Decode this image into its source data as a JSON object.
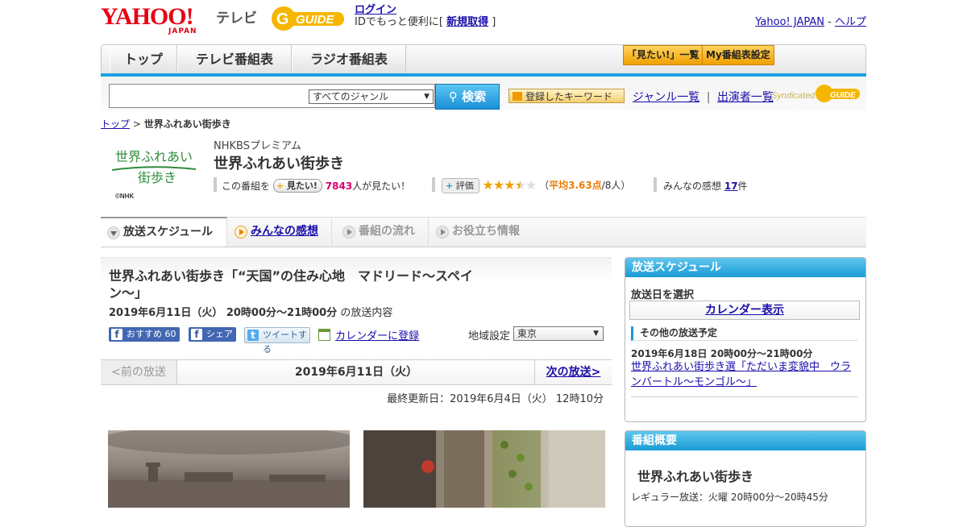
{
  "header": {
    "logo_text": "YAHOO!",
    "logo_sub": "JAPAN",
    "section": "テレビ",
    "gguide_text": "GUIDE",
    "login_link": "ログイン",
    "login_desc_pre": "IDでもっと便利に[",
    "register_link": "新規取得",
    "login_desc_post": "]",
    "yahoo_japan_link": "Yahoo! JAPAN",
    "separator": "-",
    "help_link": "ヘルプ"
  },
  "nav": {
    "tabs": [
      "トップ",
      "テレビ番組表",
      "ラジオ番組表"
    ],
    "mitai_list": "「見たい!」一覧",
    "my_schedule": "My番組表設定"
  },
  "search": {
    "placeholder": "",
    "genre_selected": "すべてのジャンル",
    "search_button": "検索",
    "keyword_button": "登録したキーワード",
    "genre_list_link": "ジャンル一覧",
    "link_separator": "|",
    "performer_list_link": "出演者一覧",
    "syndicated": "Syndicated"
  },
  "breadcrumb": {
    "top": "トップ",
    "separator": ">",
    "current": "世界ふれあい街歩き"
  },
  "program": {
    "logo_line1": "世界ふれあい",
    "logo_line2": "街歩き",
    "logo_copyright": "©NHK",
    "channel": "NHKBSプレミアム",
    "title": "世界ふれあい街歩き",
    "mitai_pre": "この番組を",
    "mitai_button": "見たい!",
    "mitai_count": "7843",
    "mitai_post": "人が見たい！",
    "eval_button": "評価",
    "rating_stars": 3.5,
    "rating_open": "（",
    "rating_label": "平均3.63点",
    "rating_count": "/8人）",
    "reviews_pre": "みんなの感想",
    "reviews_count": "17",
    "reviews_post": "件"
  },
  "tabs": [
    {
      "label": "放送スケジュール"
    },
    {
      "label": "みんなの感想"
    },
    {
      "label": "番組の流れ"
    },
    {
      "label": "お役立ち情報"
    }
  ],
  "episode": {
    "title": "世界ふれあい街歩き「“天国”の住み心地　マドリード～スペイン～」",
    "date_bold": "2019年6月11日（火）  20時00分～21時00分",
    "date_suffix": "の放送内容",
    "fb_recommend": "おすすめ",
    "fb_count": "60",
    "fb_share": "シェア",
    "tweet": "ツイートする",
    "calendar_register": "カレンダーに登録",
    "region_label": "地域設定",
    "region_selected": "東京"
  },
  "pager": {
    "prev": "<前の放送",
    "current": "2019年6月11日（火）",
    "next": "次の放送>"
  },
  "updated": "最終更新日：2019年6月4日（火）  12時10分",
  "sidebar": {
    "schedule_head": "放送スケジュール",
    "select_date": "放送日を選択",
    "calendar_button": "カレンダー表示",
    "other_head": "その他の放送予定",
    "other_date": "2019年6月18日  20時00分～21時00分",
    "other_link": "世界ふれあい街歩き選「ただいま変貌中　ウランバートル～モンゴル～」",
    "overview_head": "番組概要",
    "overview_title": "世界ふれあい街歩き",
    "overview_regular": "レギュラー放送：火曜 20時00分～20時45分"
  }
}
